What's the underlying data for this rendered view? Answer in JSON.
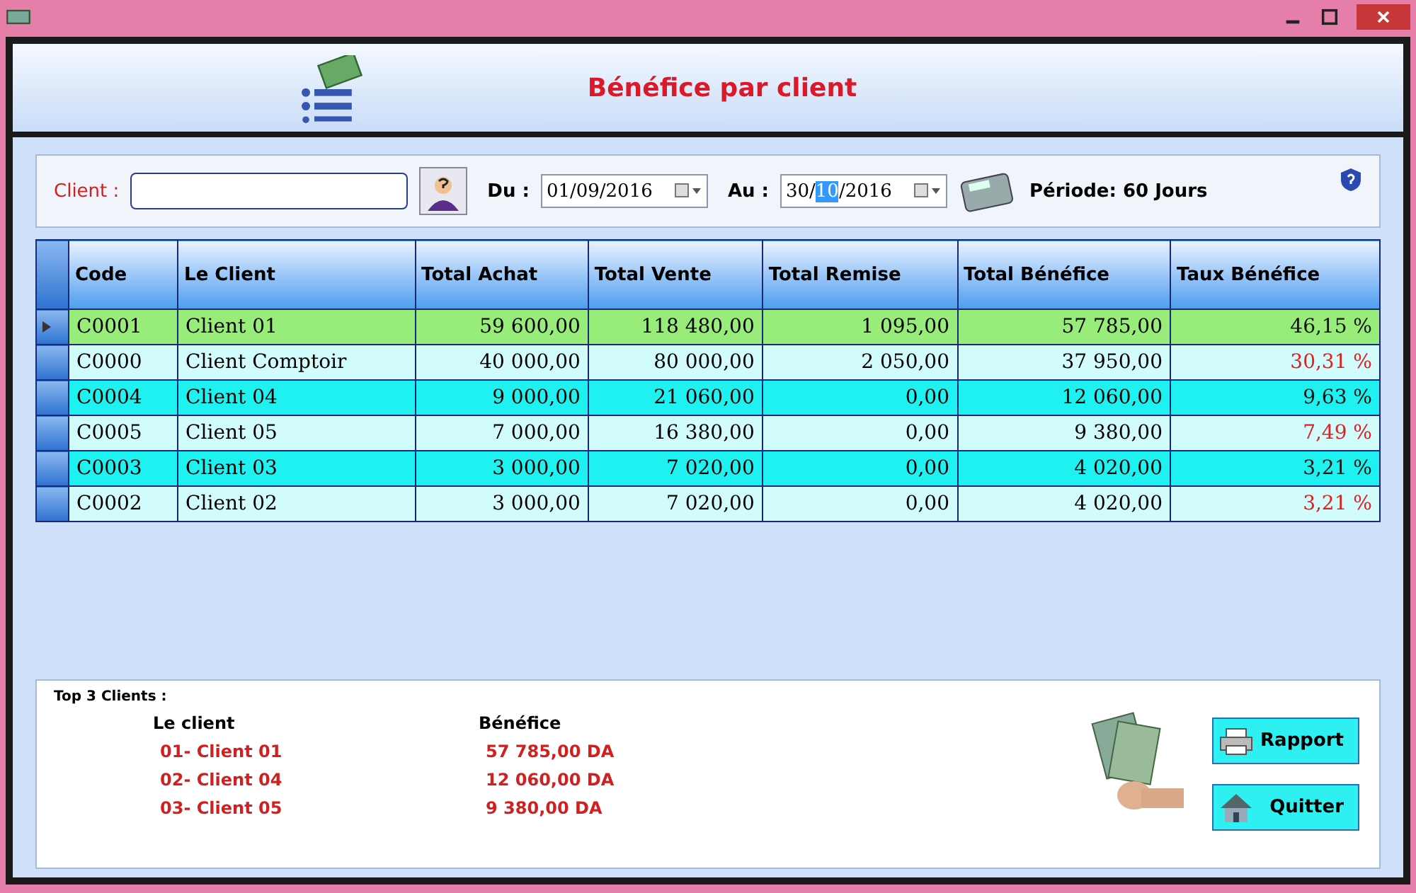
{
  "dialog": {
    "title": "Bénéfice par client"
  },
  "filter": {
    "client_label": "Client :",
    "from_label": "Du :",
    "from_date": "01/09/2016",
    "to_label": "Au :",
    "to_date_parts": [
      "30/",
      "10",
      "/2016"
    ],
    "period": "Période: 60 Jours"
  },
  "table": {
    "columns": [
      "Code",
      "Le Client",
      "Total Achat",
      "Total Vente",
      "Total Remise",
      "Total Bénéfice",
      "Taux Bénéfice"
    ],
    "rows": [
      {
        "selected": true,
        "cells": [
          "C0001",
          "Client 01",
          "59 600,00",
          "118 480,00",
          "1 095,00",
          "57 785,00",
          "46,15 %"
        ],
        "color": "#111111"
      },
      {
        "selected": false,
        "cells": [
          "C0000",
          "Client Comptoir",
          "40 000,00",
          "80 000,00",
          "2 050,00",
          "37 950,00",
          "30,31 %"
        ],
        "color": "#e02020"
      },
      {
        "selected": false,
        "cells": [
          "C0004",
          "Client 04",
          "9 000,00",
          "21 060,00",
          "0,00",
          "12 060,00",
          "9,63 %"
        ],
        "color": "#111111"
      },
      {
        "selected": false,
        "cells": [
          "C0005",
          "Client 05",
          "7 000,00",
          "16 380,00",
          "0,00",
          "9 380,00",
          "7,49 %"
        ],
        "color": "#e02020"
      },
      {
        "selected": false,
        "cells": [
          "C0003",
          "Client 03",
          "3 000,00",
          "7 020,00",
          "0,00",
          "4 020,00",
          "3,21 %"
        ],
        "color": "#111111"
      },
      {
        "selected": false,
        "cells": [
          "C0002",
          "Client 02",
          "3 000,00",
          "7 020,00",
          "0,00",
          "4 020,00",
          "3,21 %"
        ],
        "color": "#e02020"
      }
    ]
  },
  "top3": {
    "title": "Top 3 Clients :",
    "headers": [
      "Le client",
      "Bénéfice"
    ],
    "rows": [
      [
        "01- Client 01",
        "57 785,00 DA"
      ],
      [
        "02- Client 04",
        "12 060,00 DA"
      ],
      [
        "03- Client 05",
        "9 380,00 DA"
      ]
    ]
  },
  "buttons": [
    "Rapport",
    "Quitter"
  ]
}
